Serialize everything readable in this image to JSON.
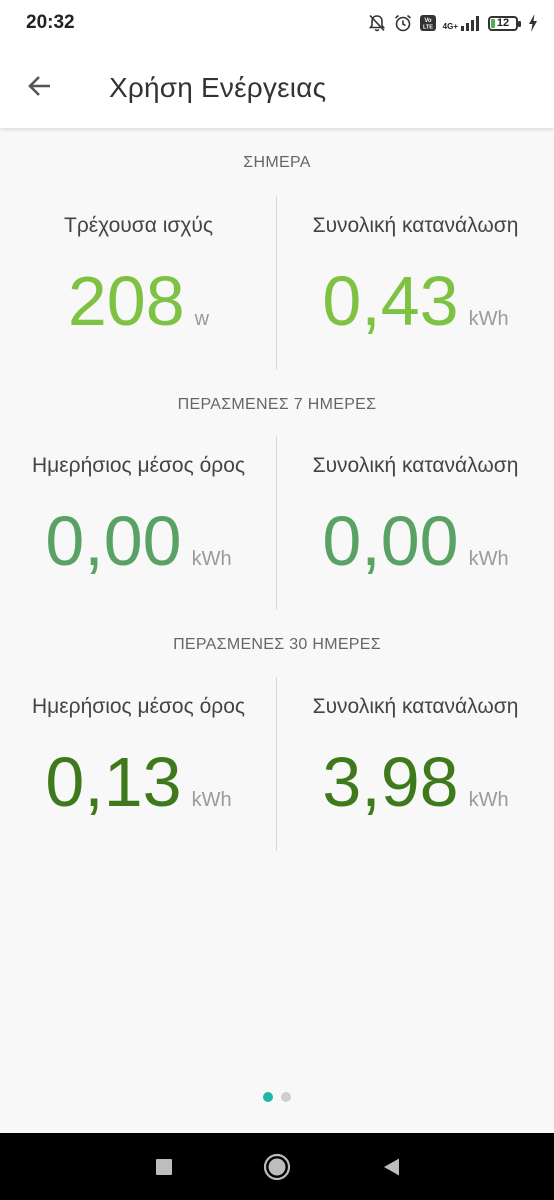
{
  "status_bar": {
    "time": "20:32",
    "battery": "12",
    "network": "4G+",
    "volte": "Vo LTE",
    "icons": [
      "bell-off-icon",
      "alarm-icon",
      "volte-icon",
      "signal-icon",
      "battery-icon",
      "charging-icon"
    ]
  },
  "app_bar": {
    "title": "Χρήση Ενέργειας",
    "back_icon": "arrow-back-icon"
  },
  "sections": [
    {
      "header": "ΣΗΜΕΡΑ",
      "color": "#7dc242",
      "left": {
        "label": "Τρέχουσα ισχύς",
        "value": "208",
        "unit": "w"
      },
      "right": {
        "label": "Συνολική κατανάλωση",
        "value": "0,43",
        "unit": "kWh"
      }
    },
    {
      "header": "ΠΕΡΑΣΜΕΝΕΣ 7 ΗΜΕΡΕΣ",
      "color": "#5aa264",
      "left": {
        "label": "Ημερήσιος μέσος όρος",
        "value": "0,00",
        "unit": "kWh"
      },
      "right": {
        "label": "Συνολική κατανάλωση",
        "value": "0,00",
        "unit": "kWh"
      }
    },
    {
      "header": "ΠΕΡΑΣΜΕΝΕΣ 30 ΗΜΕΡΕΣ",
      "color": "#3e7a1c",
      "left": {
        "label": "Ημερήσιος μέσος όρος",
        "value": "0,13",
        "unit": "kWh"
      },
      "right": {
        "label": "Συνολική κατανάλωση",
        "value": "3,98",
        "unit": "kWh"
      }
    }
  ],
  "pager": {
    "page_count": 2,
    "active_page": 1,
    "active_color": "#1fb5a8"
  },
  "nav_bar": {
    "buttons": [
      "recents-square-icon",
      "home-circle-icon",
      "back-triangle-icon"
    ]
  }
}
